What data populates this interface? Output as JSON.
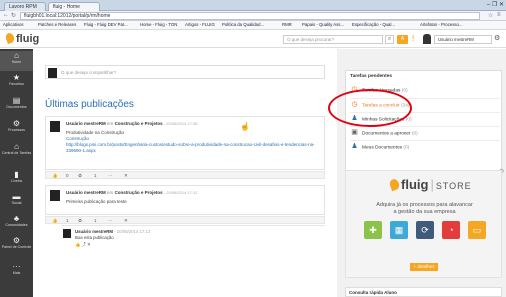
{
  "browser": {
    "tabs": [
      {
        "label": "Lavoro RPM"
      },
      {
        "label": "fluig - Home"
      }
    ],
    "window_controls": "–  ❐  ✕",
    "url": "fluigbh01.local:12012/portal/p/rm/home",
    "bookmarks": [
      "Aplicativos",
      "Patches e Releases",
      "Fluig - Fluig DEV Pat...",
      "Home - Fluig - TON",
      "Artigos - FLUIG",
      "Política da Qualidad...",
      "RMR",
      "Papais - Quality Ass...",
      "Especificação - Qual...",
      "Artefatos - Processo..."
    ]
  },
  "header": {
    "logo": "fluig",
    "search_placeholder": "O que deseja procurar?",
    "search_icon": "search-icon",
    "alert_badge": "A",
    "warn_badge": "!",
    "user_name": "Usuário mestreRM"
  },
  "sidebar": {
    "items": [
      {
        "icon": "home-icon",
        "glyph": "⌂",
        "label": "Home"
      },
      {
        "icon": "star-icon",
        "glyph": "★",
        "label": "Favoritos"
      },
      {
        "icon": "documents-icon",
        "glyph": "▤",
        "label": "Documentos"
      },
      {
        "icon": "processes-icon",
        "glyph": "⚙",
        "label": "Processos"
      },
      {
        "icon": "task-center-icon",
        "glyph": "⌂",
        "label": "Central de Tarefas"
      },
      {
        "icon": "files-icon",
        "glyph": "▮",
        "label": "Líxeira"
      },
      {
        "icon": "social-icon",
        "glyph": "▬",
        "label": "Social"
      },
      {
        "icon": "communities-icon",
        "glyph": "♣",
        "label": "Comunidades"
      },
      {
        "icon": "control-panel-icon",
        "glyph": "⚙",
        "label": "Painel de Controle"
      },
      {
        "icon": "more-icon",
        "glyph": "···",
        "label": "Mais"
      }
    ]
  },
  "main": {
    "composer_placeholder": "O que deseja compartilhar?",
    "section_title": "Últimas publicações",
    "posts": [
      {
        "author": "Usuário mestreRM",
        "in": "em",
        "community": "Construção e Projetos",
        "date": "- 20/08/2014 17:38",
        "lines": [
          "Produtividade na Construção",
          "Construção"
        ],
        "link": "http://blogs.pini.com.br/posts/Engenharia-custos/estudo-sobre-a-produtividade-na-construcao-civil-desafios-e-tendencias-na-339690-1.aspx",
        "actions": {
          "like": "👍",
          "like_count": "0",
          "share": "♻",
          "comment_count": "1",
          "more": "⋯",
          "x": "✕"
        }
      },
      {
        "author": "Usuário mestreRM",
        "in": "em",
        "community": "Construção e Projetos",
        "date": "- 20/08/2014 17:12",
        "lines": [
          "Primeira publicação para teste"
        ],
        "actions": {
          "like": "👍",
          "like_count": "1",
          "share": "♻",
          "comment_count": "1",
          "more": "⋯",
          "x": "✕"
        }
      }
    ],
    "comment": {
      "author": "Usuário mestreRM",
      "date": "- 20/08/2014 17:13",
      "text": "Boa esta publicação",
      "actions": "👍  ⤴  ✕"
    }
  },
  "tasks_panel": {
    "title": "Tarefas pendentes",
    "items": [
      {
        "icon": "clock-late-icon",
        "glyph": "◷",
        "label": "Tarefas Atrasadas",
        "count": "(0)"
      },
      {
        "icon": "clock-todo-icon",
        "glyph": "◷",
        "label": "Tarefas a concluir",
        "count": "(34)"
      },
      {
        "icon": "requests-icon",
        "glyph": "♟",
        "label": "Minhas Solicitações",
        "count": "(0)"
      },
      {
        "icon": "doc-approve-icon",
        "glyph": "▣",
        "label": "Documentos a aprover",
        "count": "(0)"
      },
      {
        "icon": "my-docs-icon",
        "glyph": "♟",
        "label": "Meus Documentos",
        "count": "(0)"
      }
    ]
  },
  "store": {
    "logo": "fluig",
    "logo_suffix": "STORE",
    "tagline_1": "Adquira já os processos para alavancar",
    "tagline_2": "a gestão da sua empresa",
    "button": "+ detalhes",
    "tiles": [
      {
        "icon": "puzzle-icon",
        "color": "#8bc34a",
        "glyph": "✚"
      },
      {
        "icon": "chart-icon",
        "color": "#3fa9d6",
        "glyph": "▦"
      },
      {
        "icon": "refresh-icon",
        "color": "#3f5a7a",
        "glyph": "⟳"
      },
      {
        "icon": "timer-icon",
        "color": "#e43b3b",
        "glyph": "◔"
      },
      {
        "icon": "screen-icon",
        "color": "#f5a623",
        "glyph": "▭"
      }
    ]
  },
  "bottom_panel": {
    "title": "Consulta rápida Aluno"
  },
  "colors": {
    "accent": "#2a6fb5",
    "orange": "#f5a623",
    "sidebar": "#3b3b3b",
    "ring": "#e0000f"
  }
}
